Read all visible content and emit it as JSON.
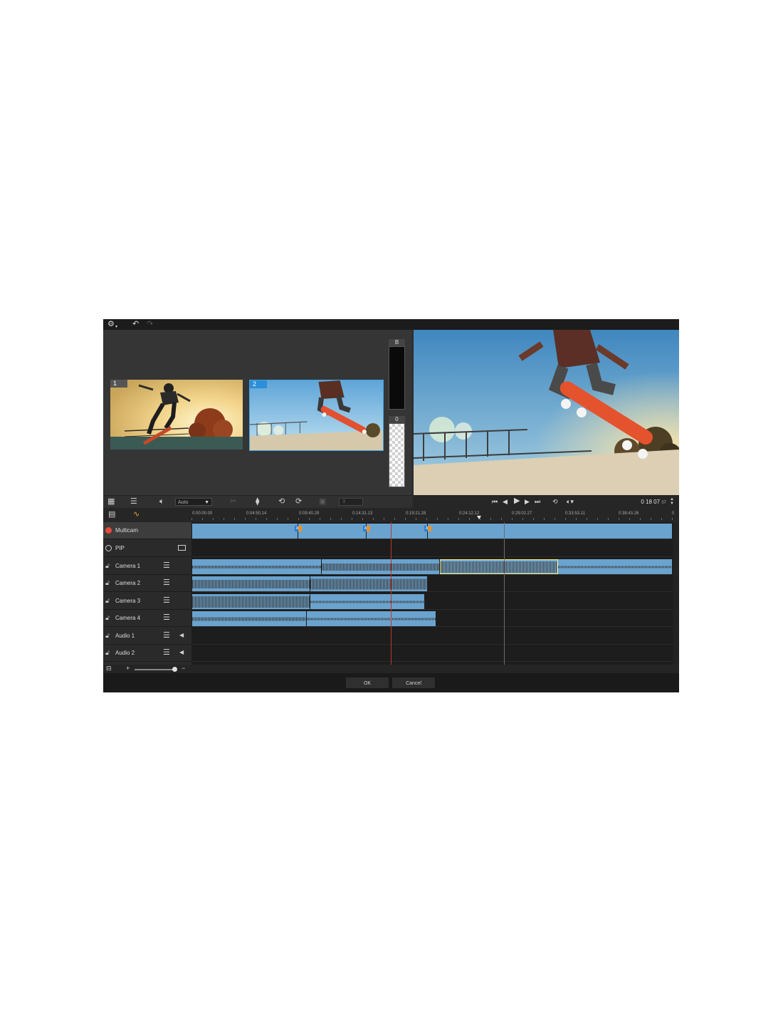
{
  "toolbar": {
    "settings_icon": "gear-icon",
    "undo_icon": "undo-icon",
    "redo_icon": "redo-icon"
  },
  "source": {
    "cameras": [
      {
        "number": "1"
      },
      {
        "number": "2"
      }
    ],
    "background_slots": [
      {
        "label": "B"
      },
      {
        "label": "0"
      }
    ],
    "toolbar": {
      "audio_mode": "Auto",
      "pip_count": "3"
    }
  },
  "playback": {
    "timecode": "0 18 07",
    "timecode_frames": "07"
  },
  "ruler": {
    "labels": [
      "0:00:00.00",
      "0:04:50.14",
      "0:09:40.29",
      "0:14:31.13",
      "0:19:21.28",
      "0:24:12.12",
      "0:29:02.27",
      "0:33:53.11",
      "0:38:43.26",
      "0"
    ]
  },
  "tracks": [
    {
      "name": "Multicam",
      "type": "multicam"
    },
    {
      "name": "PIP",
      "type": "pip"
    },
    {
      "name": "Camera 1",
      "type": "camera"
    },
    {
      "name": "Camera 2",
      "type": "camera"
    },
    {
      "name": "Camera 3",
      "type": "camera"
    },
    {
      "name": "Camera 4",
      "type": "camera"
    },
    {
      "name": "Audio 1",
      "type": "audio"
    },
    {
      "name": "Audio 2",
      "type": "audio"
    }
  ],
  "zoom": {
    "plus": "+",
    "minus": "−"
  },
  "footer": {
    "ok_label": "OK",
    "cancel_label": "Cancel"
  },
  "colors": {
    "clip": "#6aa3ce",
    "selected_clip_border": "#f1e56a",
    "active_camera_border": "#3ea4e4",
    "playhead": "#b9372e",
    "record_dot": "#e64a3b"
  }
}
